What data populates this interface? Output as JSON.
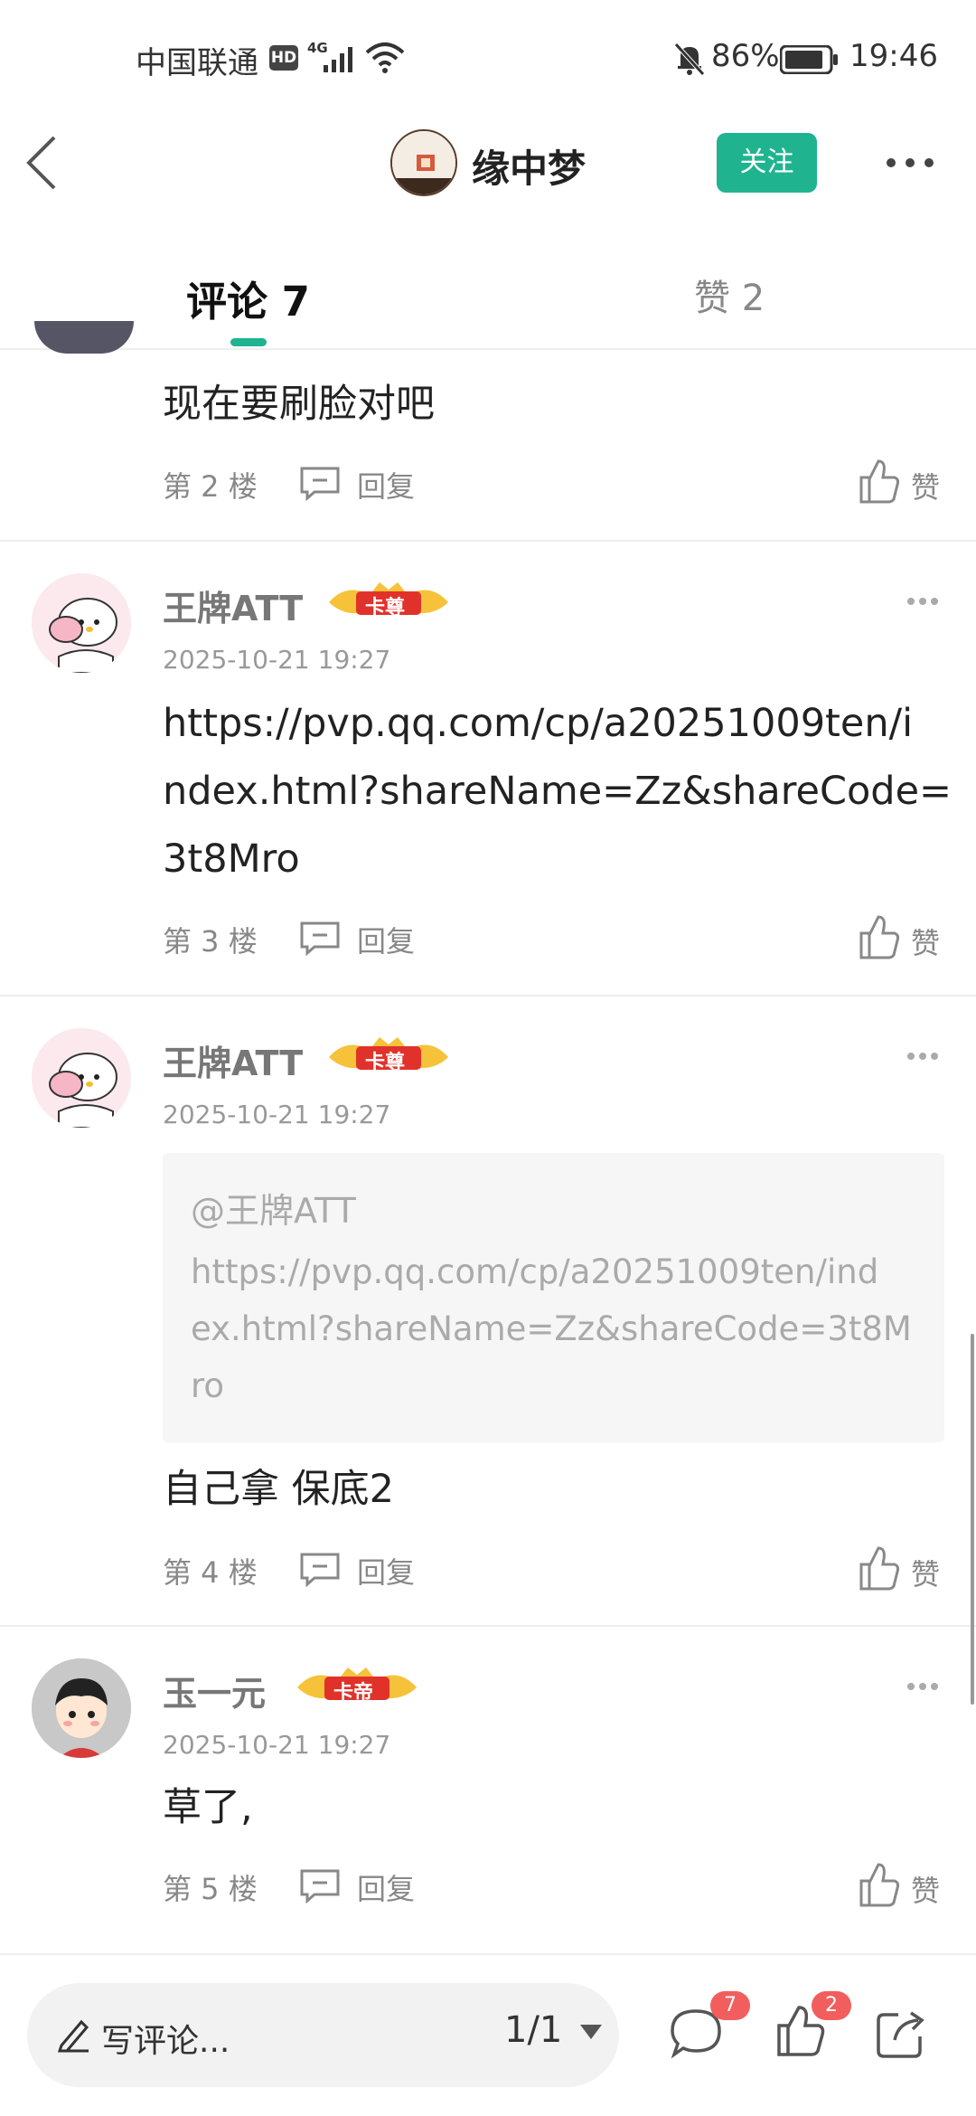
{
  "status_bar": {
    "carrier": "中国联通",
    "hd": "HD",
    "network": "4G",
    "battery": "86%",
    "time": "19:46"
  },
  "header": {
    "user_name": "缘中梦",
    "follow_label": "关注"
  },
  "tabs": {
    "comments": "评论 7",
    "likes": "赞 2"
  },
  "comments": [
    {
      "content": "现在要刷脸对吧",
      "floor": "第 2 楼",
      "reply": "回复",
      "like": "赞"
    },
    {
      "user": "王牌ATT",
      "badge": "卡尊",
      "time": "2025-10-21 19:27",
      "content_lines": [
        "https://pvp.qq.com/cp/a20251009ten/i",
        "ndex.html?shareName=Zz&shareCode=",
        "3t8Mro"
      ],
      "floor": "第 3 楼",
      "reply": "回复",
      "like": "赞"
    },
    {
      "user": "王牌ATT",
      "badge": "卡尊",
      "time": "2025-10-21 19:27",
      "quote_user": "@王牌ATT",
      "quote_lines": [
        "https://pvp.qq.com/cp/a20251009ten/ind",
        "ex.html?shareName=Zz&shareCode=3t8M",
        "ro"
      ],
      "content": "自己拿 保底2",
      "floor": "第 4 楼",
      "reply": "回复",
      "like": "赞"
    },
    {
      "user": "玉一元",
      "badge": "卡帝",
      "time": "2025-10-21 19:27",
      "content": "草了,",
      "floor": "第 5 楼",
      "reply": "回复",
      "like": "赞"
    }
  ],
  "bottom_bar": {
    "placeholder": "写评论...",
    "page": "1/1",
    "comment_count": "7",
    "like_count": "2"
  },
  "colors": {
    "accent": "#1fb48f",
    "badge_red": "#f25d5d"
  },
  "icons": [
    "back-icon",
    "more-icon",
    "reply-icon",
    "like-icon",
    "pencil-icon",
    "dropdown-icon",
    "comment-icon",
    "share-icon"
  ]
}
